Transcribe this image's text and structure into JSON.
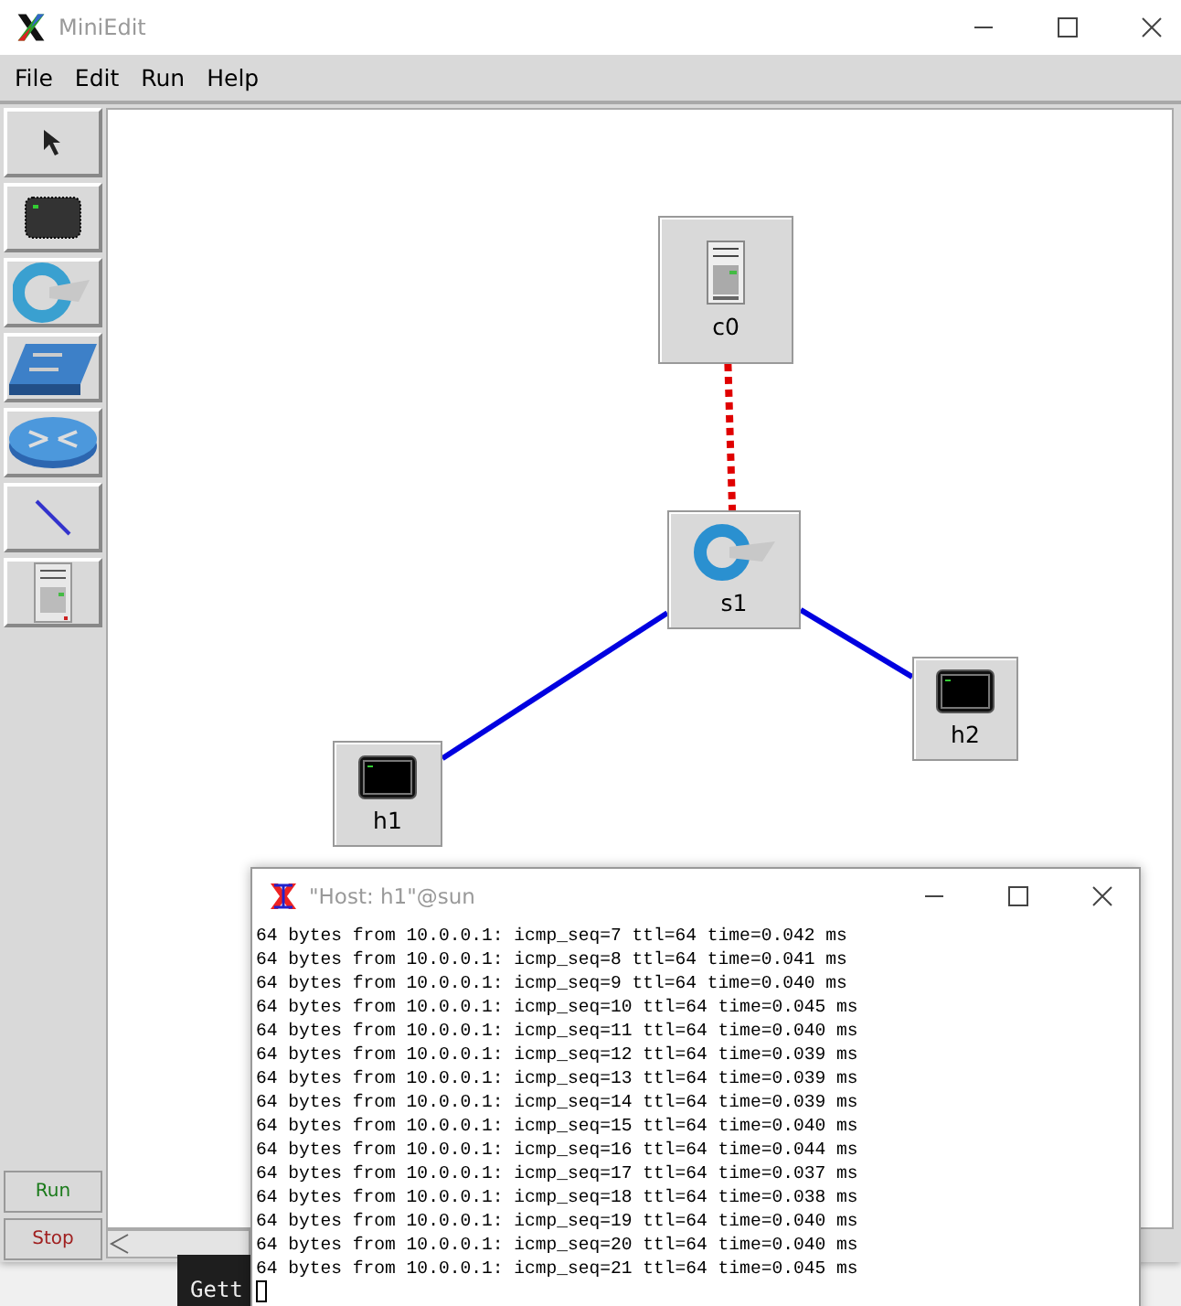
{
  "window": {
    "title": "MiniEdit"
  },
  "menu": [
    "File",
    "Edit",
    "Run",
    "Help"
  ],
  "tools": [
    {
      "kind": "select"
    },
    {
      "kind": "host"
    },
    {
      "kind": "switch"
    },
    {
      "kind": "legacy-switch"
    },
    {
      "kind": "router"
    },
    {
      "kind": "link"
    },
    {
      "kind": "controller"
    }
  ],
  "run_buttons": [
    {
      "label": "Run",
      "kind": "run"
    },
    {
      "label": "Stop",
      "kind": "stop"
    }
  ],
  "nodes": [
    {
      "label": "c0",
      "kind": "controller"
    },
    {
      "label": "s1",
      "kind": "switch"
    },
    {
      "label": "h2",
      "kind": "host"
    },
    {
      "label": "h1",
      "kind": "host"
    }
  ],
  "links": [
    {
      "kind": "control"
    },
    {
      "kind": "data"
    },
    {
      "kind": "data"
    }
  ],
  "terminal": {
    "title": "\"Host: h1\"@sun",
    "lines": [
      "64 bytes from 10.0.0.1: icmp_seq=7 ttl=64 time=0.042 ms",
      "64 bytes from 10.0.0.1: icmp_seq=8 ttl=64 time=0.041 ms",
      "64 bytes from 10.0.0.1: icmp_seq=9 ttl=64 time=0.040 ms",
      "64 bytes from 10.0.0.1: icmp_seq=10 ttl=64 time=0.045 ms",
      "64 bytes from 10.0.0.1: icmp_seq=11 ttl=64 time=0.040 ms",
      "64 bytes from 10.0.0.1: icmp_seq=12 ttl=64 time=0.039 ms",
      "64 bytes from 10.0.0.1: icmp_seq=13 ttl=64 time=0.039 ms",
      "64 bytes from 10.0.0.1: icmp_seq=14 ttl=64 time=0.039 ms",
      "64 bytes from 10.0.0.1: icmp_seq=15 ttl=64 time=0.040 ms",
      "64 bytes from 10.0.0.1: icmp_seq=16 ttl=64 time=0.044 ms",
      "64 bytes from 10.0.0.1: icmp_seq=17 ttl=64 time=0.037 ms",
      "64 bytes from 10.0.0.1: icmp_seq=18 ttl=64 time=0.038 ms",
      "64 bytes from 10.0.0.1: icmp_seq=19 ttl=64 time=0.040 ms",
      "64 bytes from 10.0.0.1: icmp_seq=20 ttl=64 time=0.040 ms",
      "64 bytes from 10.0.0.1: icmp_seq=21 ttl=64 time=0.045 ms"
    ]
  },
  "background_terminal": {
    "text": "Gett"
  }
}
